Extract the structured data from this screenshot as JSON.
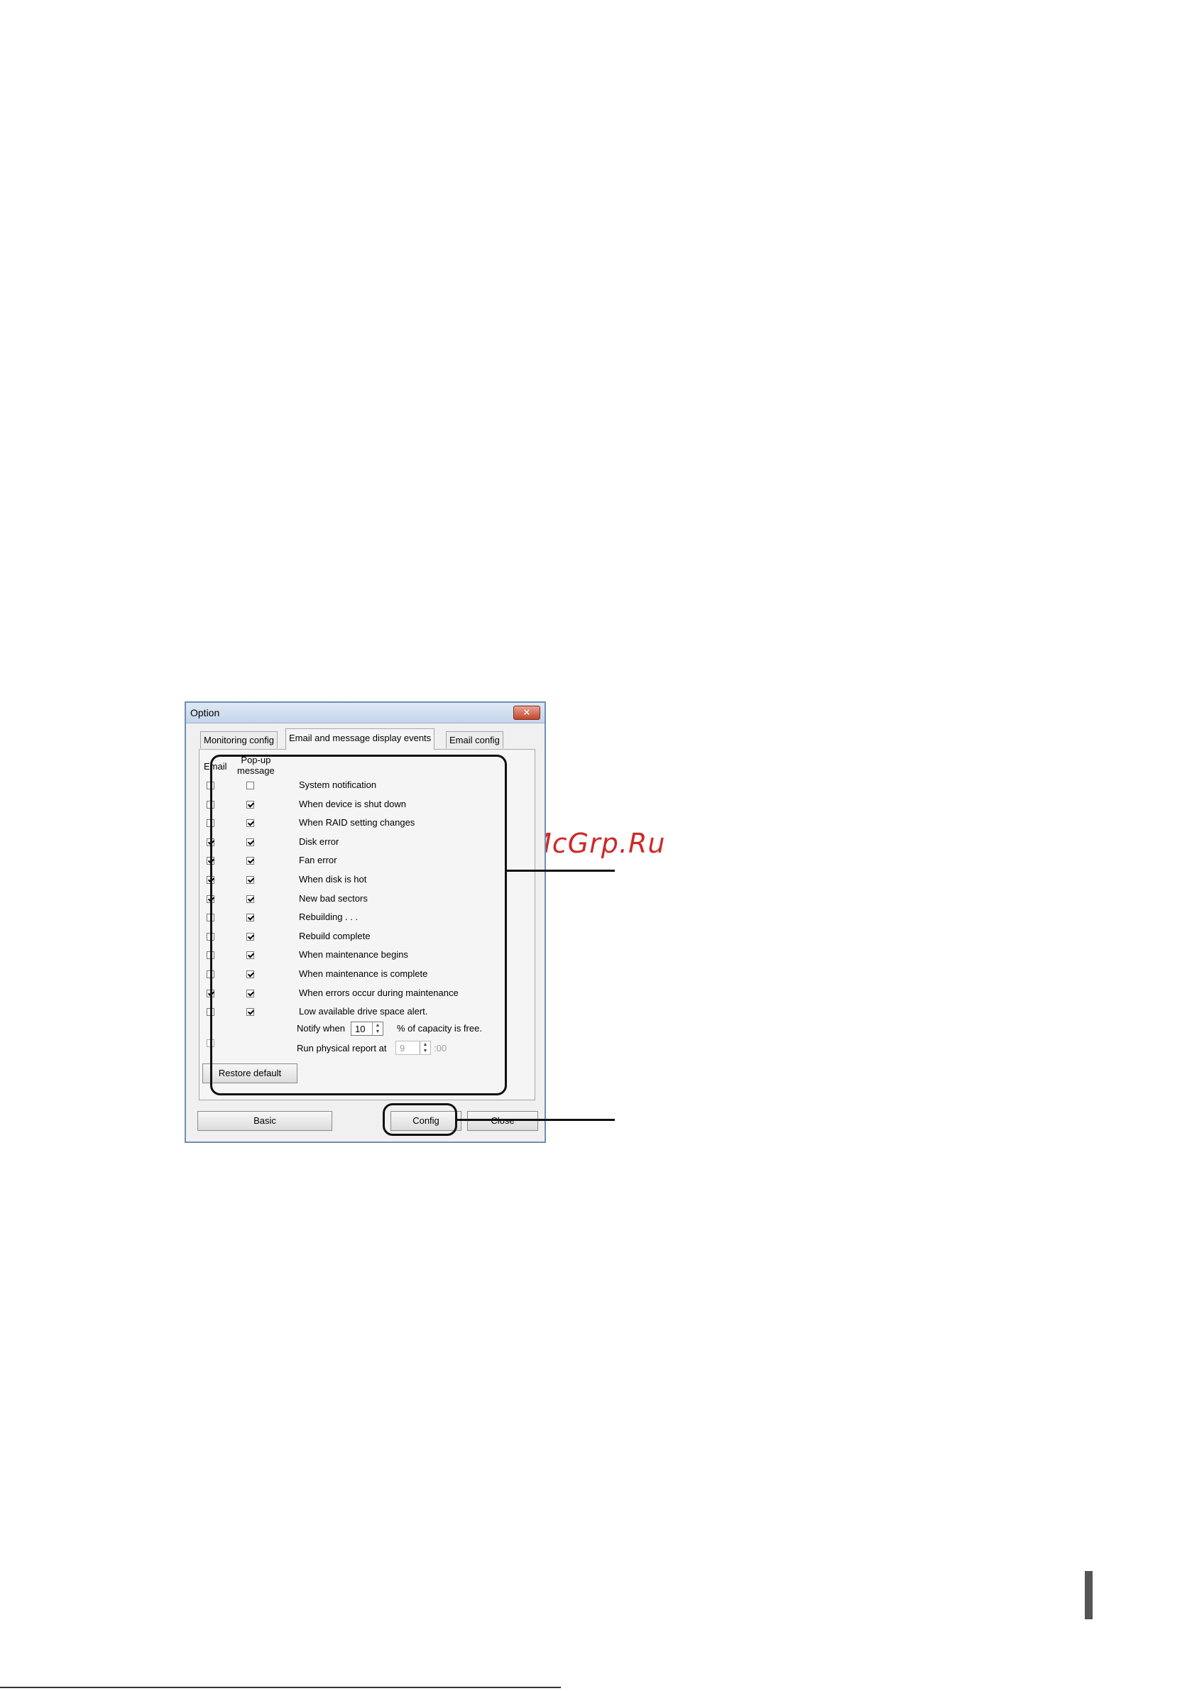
{
  "window": {
    "title": "Option",
    "close_glyph": "✕"
  },
  "tabs": [
    {
      "label": "Monitoring config"
    },
    {
      "label": "Email and message display events"
    },
    {
      "label": "Email config"
    }
  ],
  "columns": {
    "email": "Email",
    "popup_line1": "Pop-up",
    "popup_line2": "message"
  },
  "events": [
    {
      "label": "System notification",
      "email": false,
      "popup": false
    },
    {
      "label": "When device is shut down",
      "email": false,
      "popup": true
    },
    {
      "label": "When RAID setting changes",
      "email": false,
      "popup": true
    },
    {
      "label": "Disk error",
      "email": true,
      "popup": true
    },
    {
      "label": "Fan error",
      "email": true,
      "popup": true
    },
    {
      "label": "When disk is hot",
      "email": true,
      "popup": true
    },
    {
      "label": "New bad sectors",
      "email": true,
      "popup": true
    },
    {
      "label": "Rebuilding . . .",
      "email": false,
      "popup": true
    },
    {
      "label": "Rebuild complete",
      "email": false,
      "popup": true
    },
    {
      "label": "When maintenance begins",
      "email": false,
      "popup": true
    },
    {
      "label": "When maintenance is complete",
      "email": false,
      "popup": true
    },
    {
      "label": "When errors occur during maintenance",
      "email": true,
      "popup": true
    },
    {
      "label": "Low available drive space alert.",
      "email": false,
      "popup": true
    }
  ],
  "notify": {
    "prefix": "Notify when",
    "value": "10",
    "suffix": "% of capacity is free."
  },
  "physical_report": {
    "label": "Run physical report at",
    "value": "9",
    "suffix": ":00",
    "checked": false
  },
  "buttons": {
    "restore_default": "Restore default",
    "basic": "Basic",
    "config": "Config",
    "close": "Close"
  },
  "watermark": "McGrp.Ru",
  "colors": {
    "watermark": "#cc2a2a",
    "titlebar": "#c4d5ea",
    "close_button": "#c2452d"
  }
}
